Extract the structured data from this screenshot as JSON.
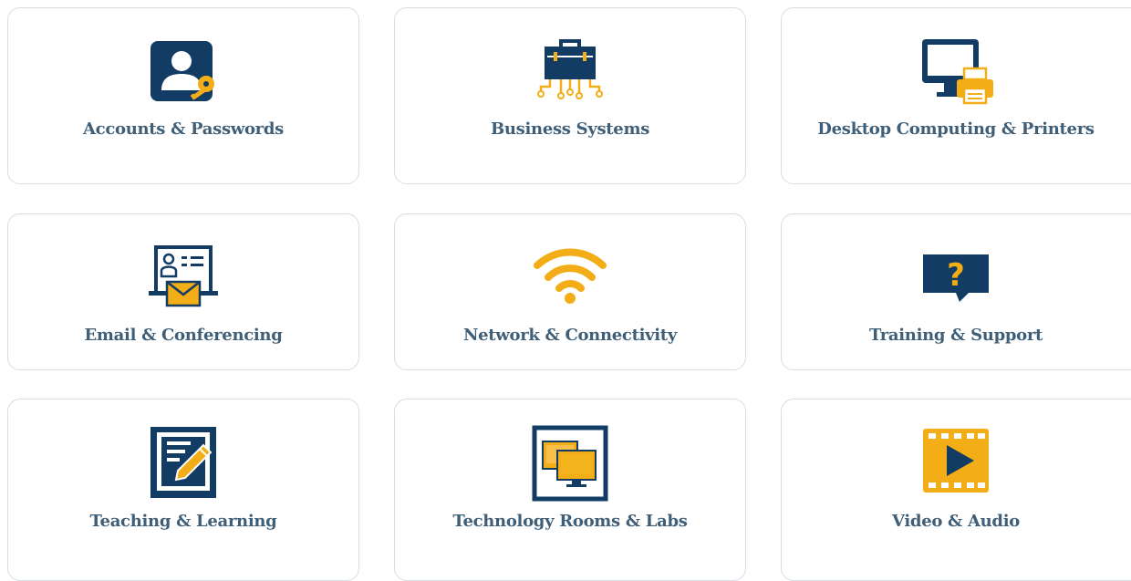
{
  "colors": {
    "navy": "#123c63",
    "gold": "#f2ad17",
    "label": "#3f5f78",
    "border": "#d9dde2"
  },
  "cards": [
    {
      "label": "Accounts & Passwords",
      "icon": "account-key-icon"
    },
    {
      "label": "Business Systems",
      "icon": "briefcase-circuit-icon"
    },
    {
      "label": "Desktop Computing & Printers",
      "icon": "monitor-printer-icon"
    },
    {
      "label": "Email & Conferencing",
      "icon": "email-conference-icon"
    },
    {
      "label": "Network & Connectivity",
      "icon": "wifi-icon"
    },
    {
      "label": "Training & Support",
      "icon": "question-bubble-icon"
    },
    {
      "label": "Teaching & Learning",
      "icon": "notebook-pencil-icon"
    },
    {
      "label": "Technology Rooms & Labs",
      "icon": "lab-monitors-icon"
    },
    {
      "label": "Video & Audio",
      "icon": "video-play-icon"
    }
  ]
}
